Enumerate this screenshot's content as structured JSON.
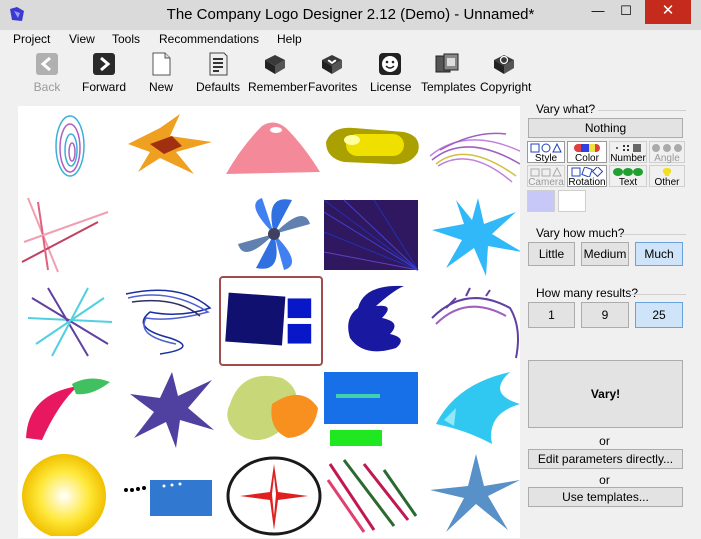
{
  "window": {
    "title": "The Company Logo Designer 2.12 (Demo) - Unnamed*",
    "minimize_glyph": "—",
    "maximize_glyph": "☐",
    "close_glyph": "✕"
  },
  "menu": [
    "Project",
    "View",
    "Tools",
    "Recommendations",
    "Help"
  ],
  "toolbar": [
    {
      "label": "Back",
      "icon": "back-arrow-icon",
      "enabled": false
    },
    {
      "label": "Forward",
      "icon": "forward-arrow-icon",
      "enabled": true
    },
    {
      "label": "New",
      "icon": "new-document-icon",
      "enabled": true
    },
    {
      "label": "Defaults",
      "icon": "defaults-document-icon",
      "enabled": true
    },
    {
      "label": "Remember",
      "icon": "book-icon",
      "enabled": true
    },
    {
      "label": "Favorites",
      "icon": "heart-book-icon",
      "enabled": true
    },
    {
      "label": "License",
      "icon": "smiley-icon",
      "enabled": true
    },
    {
      "label": "Templates",
      "icon": "templates-icon",
      "enabled": true
    },
    {
      "label": "Copyright",
      "icon": "copyright-icon",
      "enabled": true
    }
  ],
  "gallery": {
    "selected_index": 12,
    "items": [
      "logo-swirl-rings",
      "logo-orange-splash",
      "logo-pink-mound",
      "logo-yellow-capsule",
      "logo-purple-fan",
      "logo-pink-lines",
      "logo-empty",
      "logo-blue-pinwheel",
      "logo-purple-rays-square",
      "logo-blue-star",
      "logo-asterisk-lines",
      "logo-blue-scribble",
      "logo-navy-squares",
      "logo-blue-spiral",
      "logo-purple-arc",
      "logo-red-green-feather",
      "logo-purple-star",
      "logo-green-orange-blobs",
      "logo-blue-green-rectangles",
      "logo-cyan-fan",
      "logo-yellow-sun",
      "logo-blue-dotted-rect",
      "logo-compass",
      "logo-red-green-rays",
      "logo-blue-cross"
    ]
  },
  "panel": {
    "vary_what_label": "Vary what?",
    "nothing_button": "Nothing",
    "tabs": [
      {
        "label": "Style",
        "icon": "shapes-icon",
        "state": "on"
      },
      {
        "label": "Color",
        "icon": "color-bar-icon",
        "state": "on"
      },
      {
        "label": "Number",
        "icon": "number-dots-icon",
        "state": "off"
      },
      {
        "label": "Angle",
        "icon": "angle-circles-icon",
        "state": "dim"
      },
      {
        "label": "Camera",
        "icon": "camera-shapes-icon",
        "state": "dim"
      },
      {
        "label": "Rotation",
        "icon": "rotation-shapes-icon",
        "state": "on"
      },
      {
        "label": "Text",
        "icon": "text-blobs-icon",
        "state": "off"
      },
      {
        "label": "Other",
        "icon": "lightbulb-icon",
        "state": "off"
      }
    ],
    "swatch_colors": [
      "#c8c8f8",
      "#ffffff"
    ],
    "vary_how_much_label": "Vary how much?",
    "amount_options": [
      "Little",
      "Medium",
      "Much"
    ],
    "amount_selected": "Much",
    "how_many_label": "How many results?",
    "count_options": [
      "1",
      "9",
      "25"
    ],
    "count_selected": "25",
    "vary_button": "Vary!",
    "or_1": "or",
    "edit_params_button": "Edit parameters directly...",
    "or_2": "or",
    "use_templates_button": "Use templates..."
  },
  "colors": {
    "selected_border": "#a24d4d",
    "active_button": "#cfe4f8",
    "close_button": "#c42b1c"
  }
}
